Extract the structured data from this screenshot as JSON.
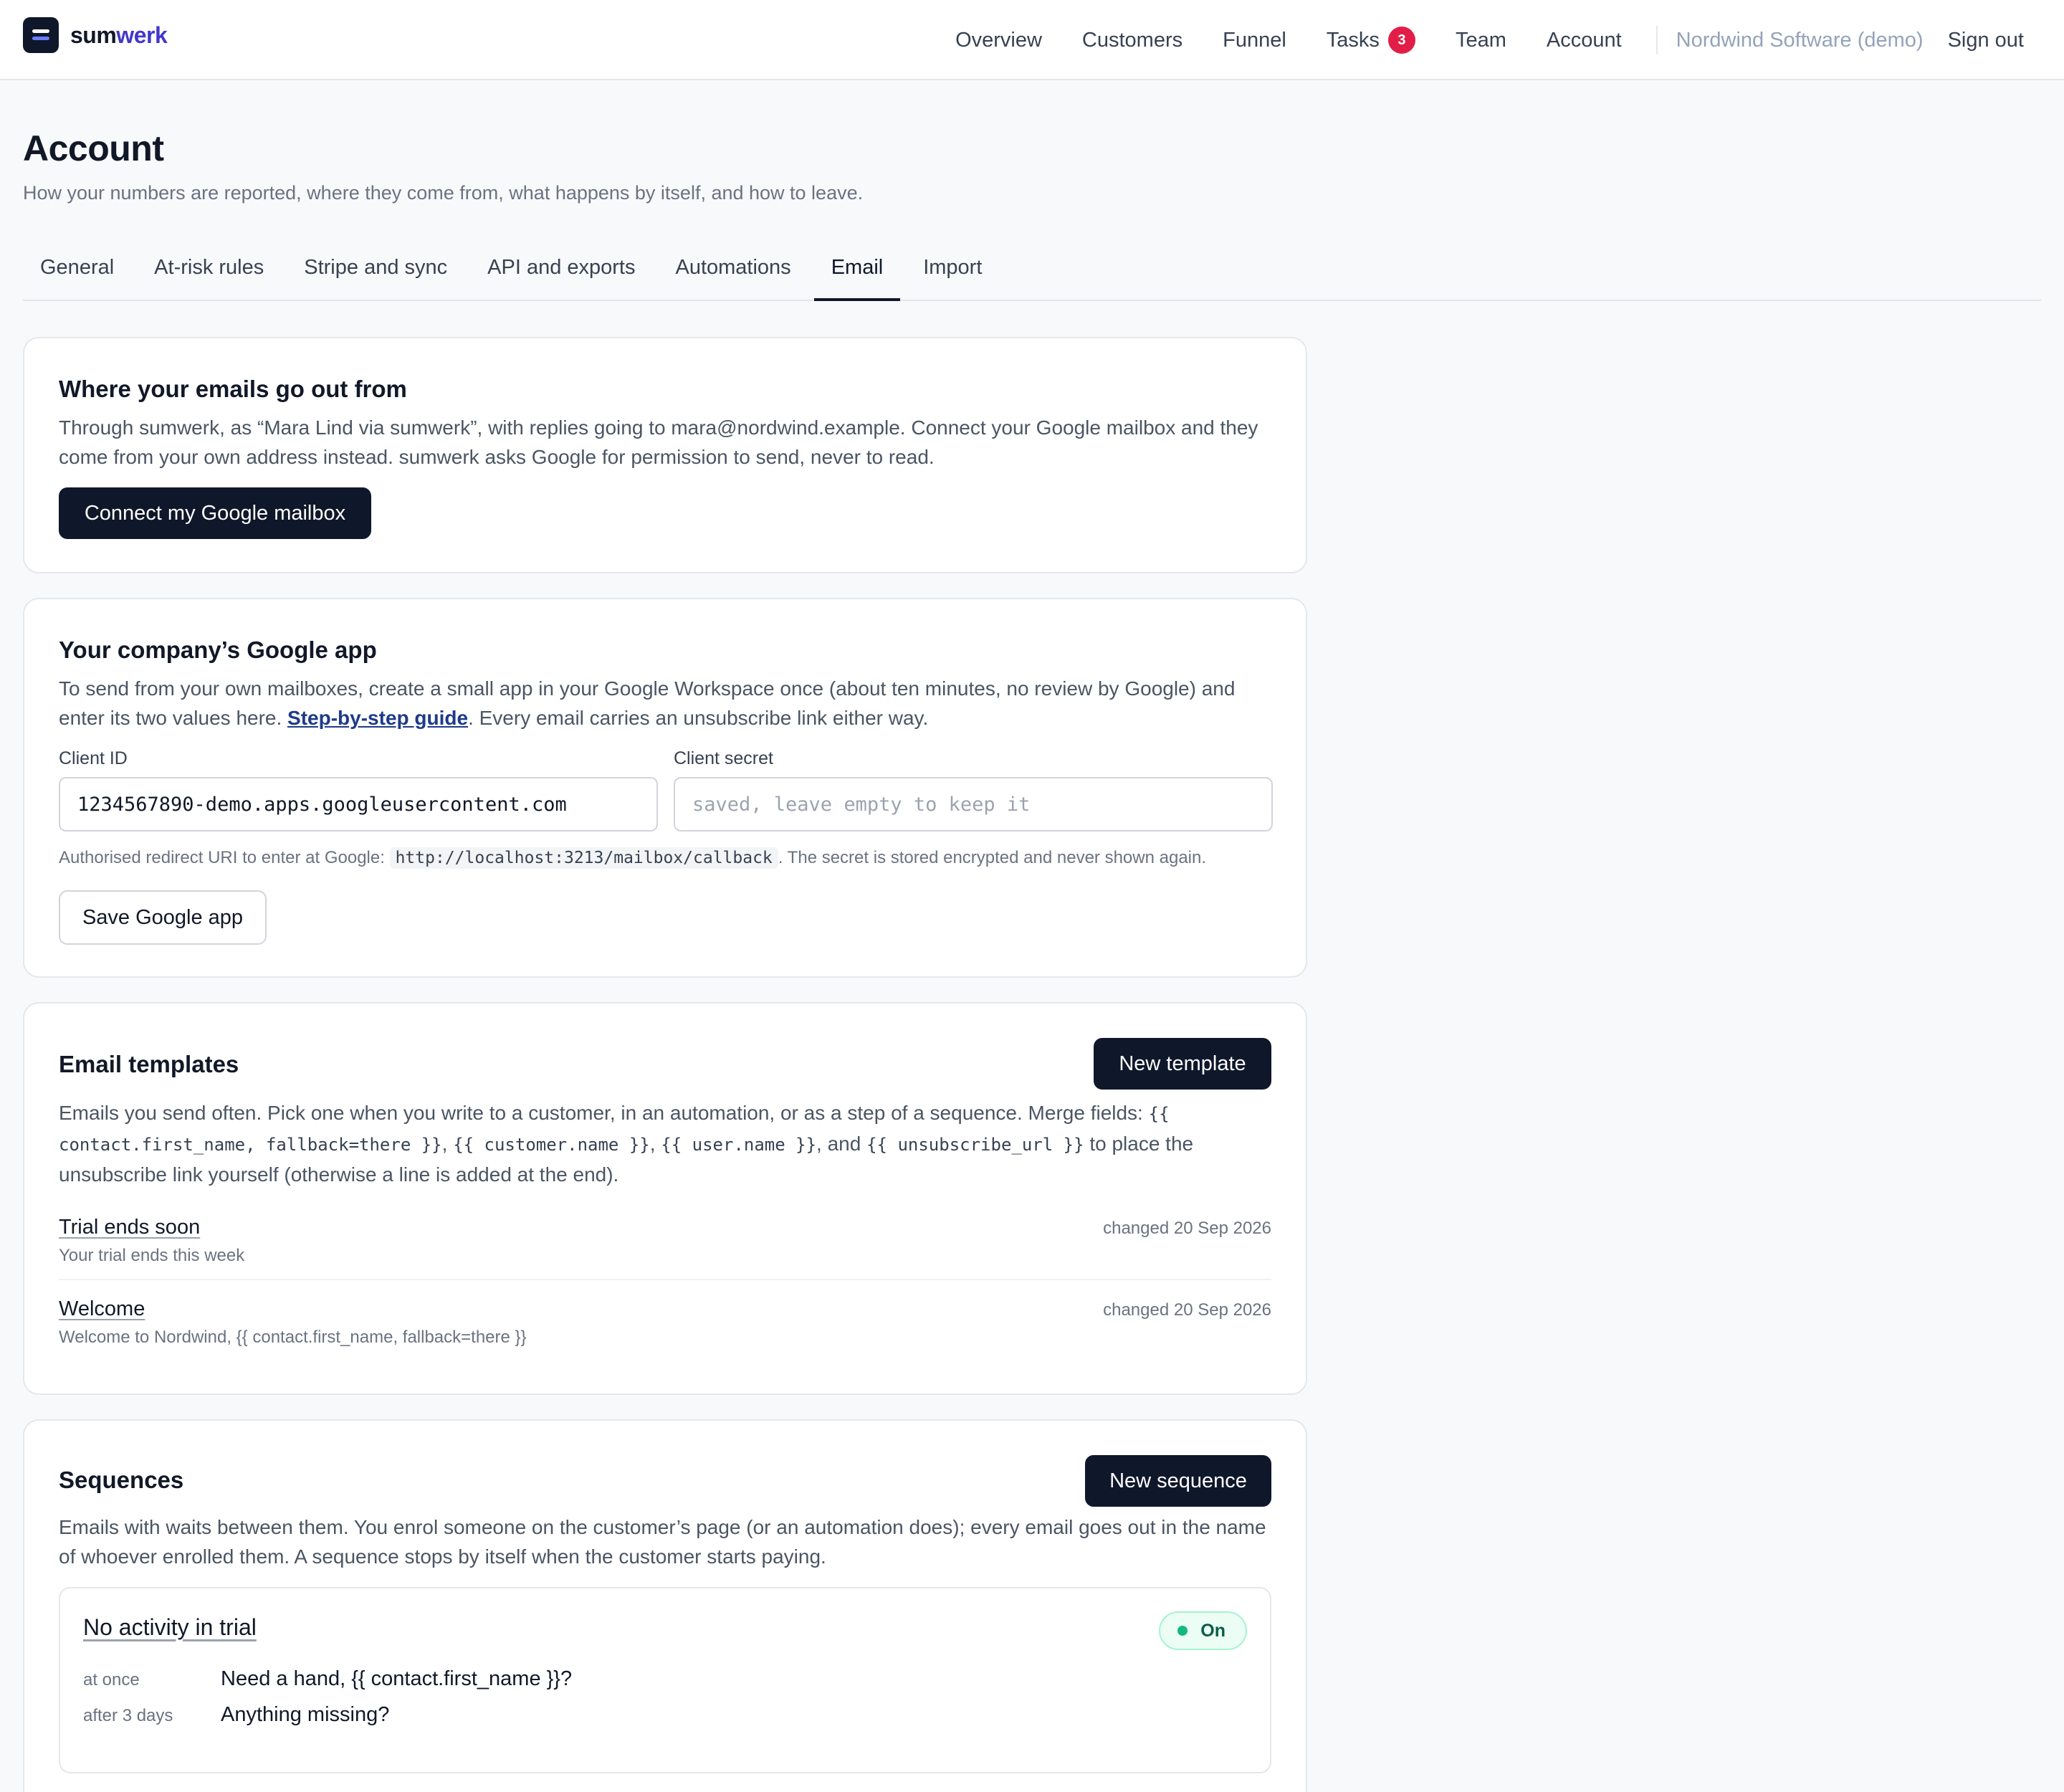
{
  "brand": {
    "name_part1": "sum",
    "name_part2": "werk"
  },
  "nav": {
    "items": [
      "Overview",
      "Customers",
      "Funnel",
      "Tasks",
      "Team",
      "Account"
    ],
    "tasks_badge": "3",
    "org": "Nordwind Software (demo)",
    "sign_out": "Sign out"
  },
  "page": {
    "title": "Account",
    "subtitle": "How your numbers are reported, where they come from, what happens by itself, and how to leave."
  },
  "tabs": [
    "General",
    "At-risk rules",
    "Stripe and sync",
    "API and exports",
    "Automations",
    "Email",
    "Import"
  ],
  "active_tab": "Email",
  "sending": {
    "title": "Where your emails go out from",
    "text": "Through sumwerk, as “Mara Lind via sumwerk”, with replies going to mara@nordwind.example. Connect your Google mailbox and they come from your own address instead. sumwerk asks Google for permission to send, never to read.",
    "button": "Connect my Google mailbox"
  },
  "google_app": {
    "title": "Your company’s Google app",
    "text_before": "To send from your own mailboxes, create a small app in your Google Workspace once (about ten minutes, no review by Google) and enter its two values here. ",
    "guide_link": "Step-by-step guide",
    "text_after": ". Every email carries an unsubscribe link either way.",
    "client_id_label": "Client ID",
    "client_id_value": "1234567890-demo.apps.googleusercontent.com",
    "client_secret_label": "Client secret",
    "client_secret_placeholder": "saved, leave empty to keep it",
    "hint_before": "Authorised redirect URI to enter at Google: ",
    "redirect_uri": "http://localhost:3213/mailbox/callback",
    "hint_after": ". The secret is stored encrypted and never shown again.",
    "save_button": "Save Google app"
  },
  "templates": {
    "title": "Email templates",
    "new_button": "New template",
    "desc_1": "Emails you send often. Pick one when you write to a customer, in an automation, or as a step of a sequence. Merge fields: ",
    "field_1": "{{ contact.first_name, fallback=there }}",
    "sep_1": ", ",
    "field_2": "{{ customer.name }}",
    "sep_2": ", ",
    "field_3": "{{ user.name }}",
    "desc_2": ", and ",
    "field_4": "{{ unsubscribe_url }}",
    "desc_3": " to place the unsubscribe link yourself (otherwise a line is added at the end).",
    "items": [
      {
        "name": "Trial ends soon",
        "subject": "Your trial ends this week",
        "changed": "changed 20 Sep 2026"
      },
      {
        "name": "Welcome",
        "subject": "Welcome to Nordwind, {{ contact.first_name, fallback=there }}",
        "changed": "changed 20 Sep 2026"
      }
    ]
  },
  "sequences": {
    "title": "Sequences",
    "new_button": "New sequence",
    "desc": "Emails with waits between them. You enrol someone on the customer’s page (or an automation does); every email goes out in the name of whoever enrolled them. A sequence stops by itself when the customer starts paying.",
    "items": [
      {
        "name": "No activity in trial",
        "status": "On",
        "steps": [
          {
            "when": "at once",
            "subject": "Need a hand, {{ contact.first_name }}?"
          },
          {
            "when": "after 3 days",
            "subject": "Anything missing?"
          }
        ]
      }
    ]
  }
}
